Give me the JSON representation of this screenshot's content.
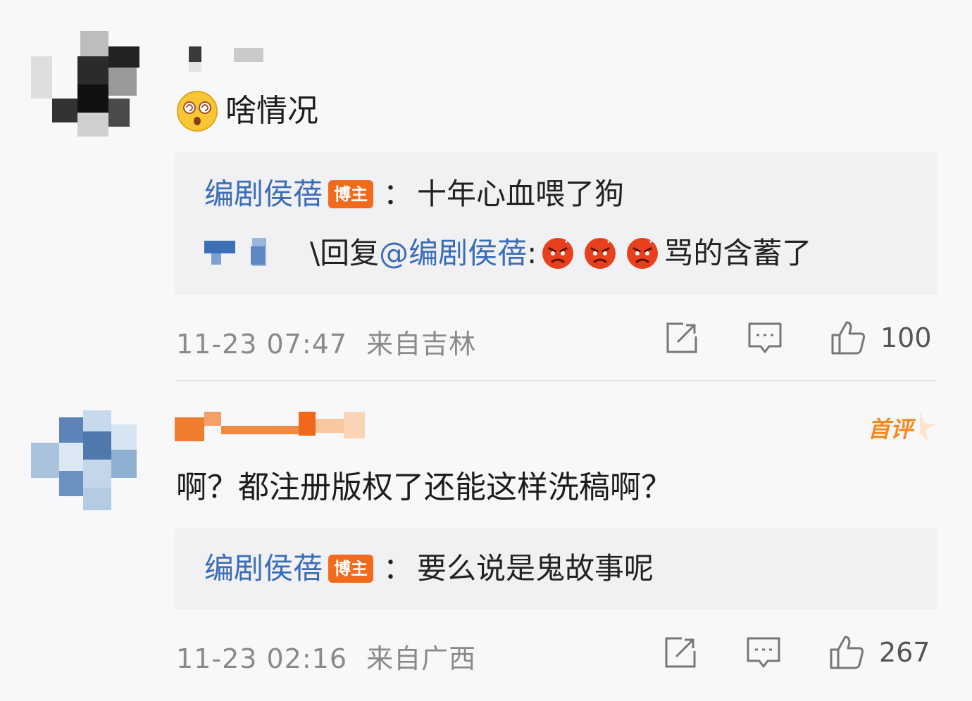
{
  "comments": [
    {
      "text": "啥情况",
      "emoji": "dizzy-face",
      "reply_lines": [
        {
          "author": "编剧侯蓓",
          "badge": "博主",
          "colon": "：",
          "text": "十年心血喂了狗"
        },
        {
          "prefix": "\\回复",
          "mention": "@编剧侯蓓",
          "colon": ":",
          "emojis": [
            "angry-face",
            "angry-face",
            "angry-face"
          ],
          "text": "骂的含蓄了"
        }
      ],
      "timestamp": "11-23 07:47",
      "location": "来自吉林",
      "likes": "100"
    },
    {
      "text": "啊？都注册版权了还能这样洗稿啊？",
      "first_comment_badge": "首评",
      "reply_lines": [
        {
          "author": "编剧侯蓓",
          "badge": "博主",
          "colon": "：",
          "text": "要么说是鬼故事呢"
        }
      ],
      "timestamp": "11-23 02:16",
      "location": "来自广西",
      "likes": "267"
    }
  ],
  "colors": {
    "author_blue": "#3a6db8",
    "badge_orange": "#f26b1d",
    "meta_gray": "#8a8a8a",
    "reply_bg": "#f1f1f4"
  }
}
